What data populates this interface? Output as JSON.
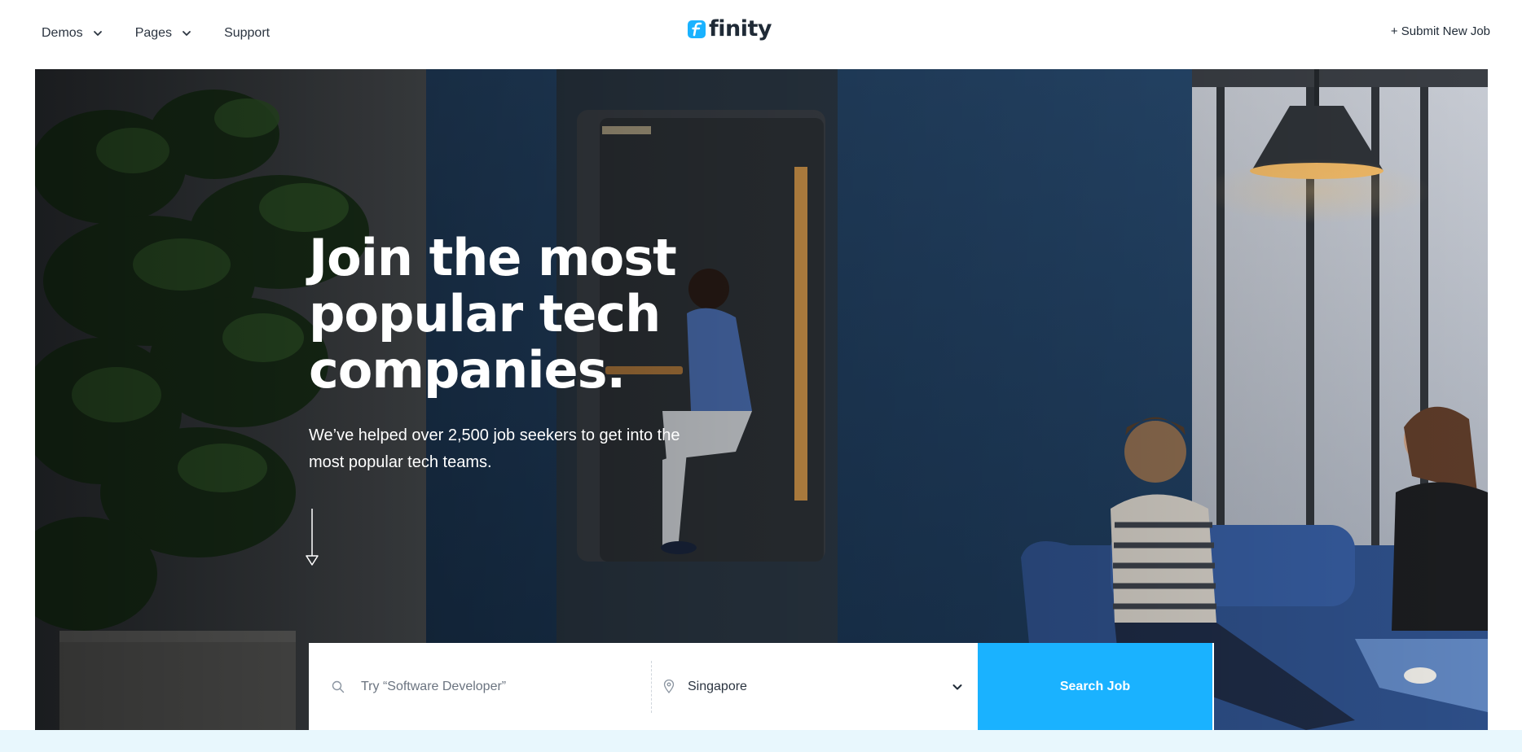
{
  "header": {
    "nav": [
      {
        "label": "Demos",
        "icon": "chevron-down-icon"
      },
      {
        "label": "Pages",
        "icon": "chevron-down-icon"
      },
      {
        "label": "Support"
      }
    ],
    "logo_text": "finity",
    "submit_label": "+ Submit New Job"
  },
  "hero": {
    "title": "Join the most popular tech companies.",
    "subtitle": "We’ve helped over 2,500 job seekers to get into the most popular tech teams.",
    "scroll_icon": "arrow-down-icon"
  },
  "search": {
    "keyword_placeholder": "Try “Software Developer”",
    "keyword_icon": "search-icon",
    "location_value": "Singapore",
    "location_icon": "map-pin-icon",
    "button_label": "Search Job"
  },
  "colors": {
    "accent": "#1ab2ff",
    "text_dark": "#1f2a36",
    "hero_overlay": "#1d3c5c",
    "footer_strip": "#e8f7fd"
  }
}
